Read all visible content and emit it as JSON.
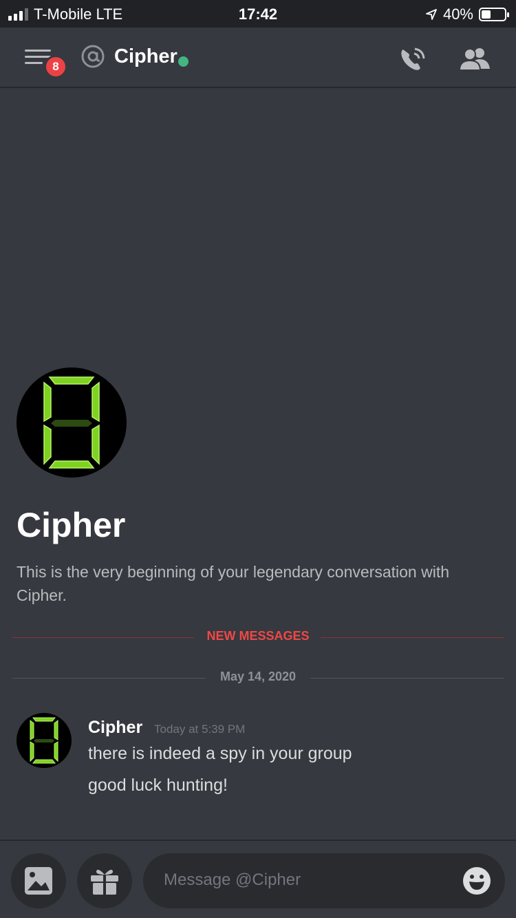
{
  "status_bar": {
    "carrier": "T-Mobile LTE",
    "time": "17:42",
    "battery_percent": "40%",
    "battery_level": 0.4
  },
  "header": {
    "unread_badge": "8",
    "channel_name": "Cipher",
    "status_color": "#43b581"
  },
  "welcome": {
    "name": "Cipher",
    "description": "This is the very beginning of your legendary conversation with Cipher."
  },
  "dividers": {
    "new_messages": "NEW MESSAGES",
    "date": "May 14, 2020"
  },
  "message": {
    "author": "Cipher",
    "timestamp": "Today at 5:39 PM",
    "lines": [
      "there is indeed a spy in your group",
      "good luck hunting!"
    ]
  },
  "composer": {
    "placeholder": "Message @Cipher"
  },
  "colors": {
    "background": "#36393f",
    "mention_red": "#f04747",
    "digit_green": "#7ed321"
  }
}
